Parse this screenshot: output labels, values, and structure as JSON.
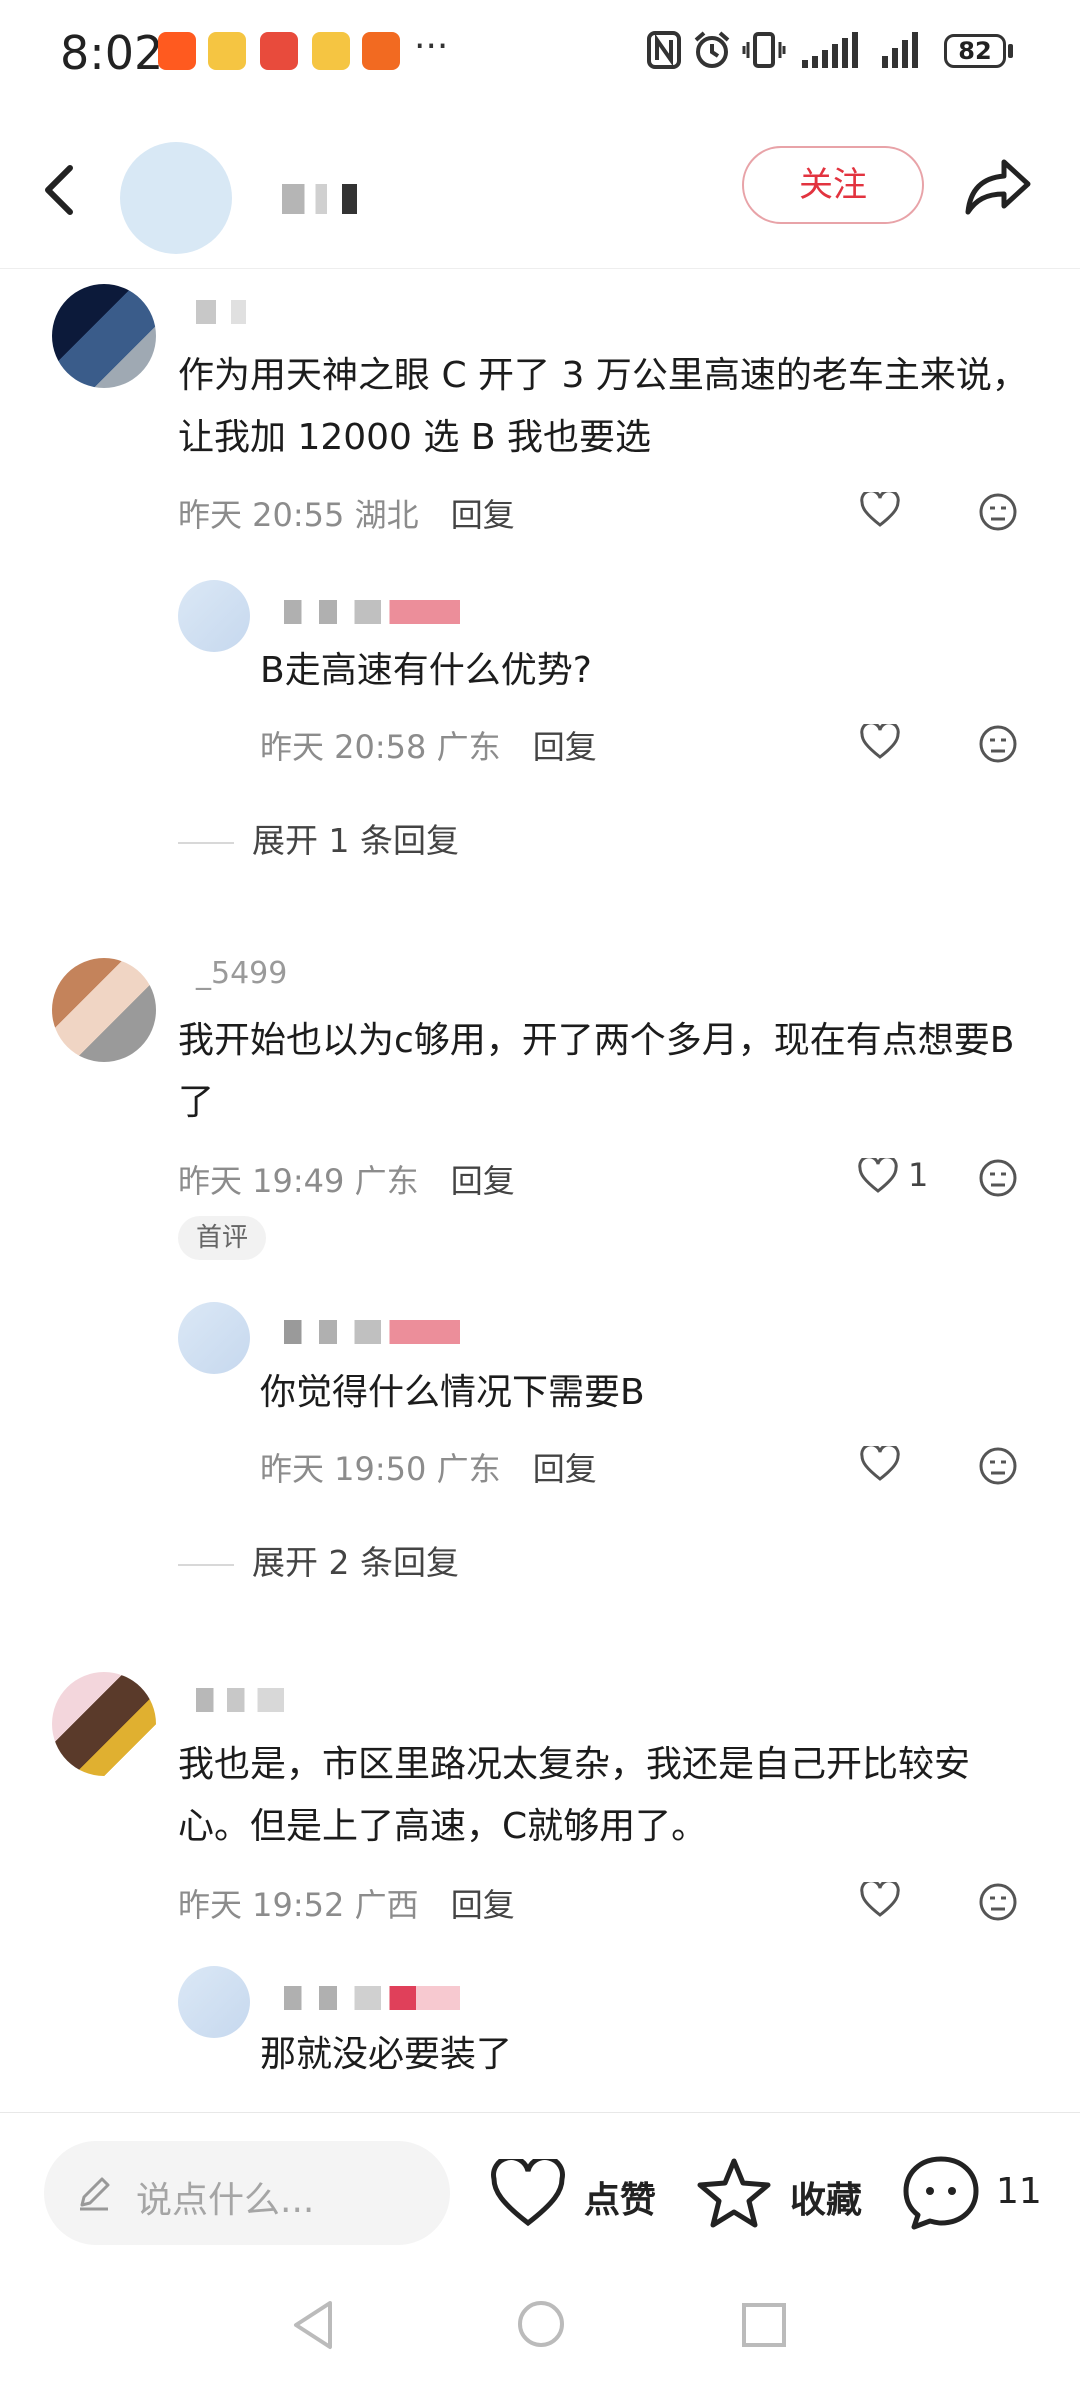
{
  "status_bar": {
    "time": "8:02",
    "battery": "82",
    "more": "···"
  },
  "header": {
    "follow_label": "关注"
  },
  "comments": [
    {
      "text": "作为用天神之眼 C 开了 3 万公里高速的老车主来说，让我加 12000 选 B 我也要选",
      "time": "昨天 20:55",
      "location": "湖北",
      "reply_label": "回复",
      "replies": [
        {
          "text": "B走高速有什么优势?",
          "time": "昨天 20:58",
          "location": "广东",
          "reply_label": "回复"
        }
      ],
      "expand_label": "展开 1 条回复"
    },
    {
      "username_partial": "_5499",
      "text": "我开始也以为c够用，开了两个多月，现在有点想要B了",
      "time": "昨天 19:49",
      "location": "广东",
      "reply_label": "回复",
      "like_count": "1",
      "badge": "首评",
      "replies": [
        {
          "text": "你觉得什么情况下需要B",
          "time": "昨天 19:50",
          "location": "广东",
          "reply_label": "回复"
        }
      ],
      "expand_label": "展开 2 条回复"
    },
    {
      "text": "我也是，市区里路况太复杂，我还是自己开比较安心。但是上了高速，C就够用了。",
      "time": "昨天 19:52",
      "location": "广西",
      "reply_label": "回复",
      "replies": [
        {
          "text": "那就没必要装了"
        }
      ]
    }
  ],
  "bottom_bar": {
    "input_placeholder": "说点什么...",
    "like_label": "点赞",
    "collect_label": "收藏",
    "comment_count": "11"
  },
  "colors": {
    "accent": "#e2333f",
    "meta": "#8c8c8c"
  },
  "icons": [
    "back-icon",
    "share-icon",
    "heart-icon",
    "dislike-face-icon",
    "pencil-icon",
    "star-icon",
    "comment-bubble-icon",
    "nav-back-icon",
    "nav-home-icon",
    "nav-recent-icon"
  ]
}
